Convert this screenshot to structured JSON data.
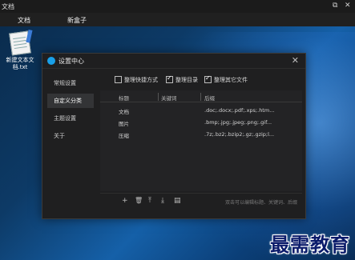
{
  "window_title": "文档",
  "taskbar": {
    "restore_glyph": "⧉",
    "close_glyph": "✕"
  },
  "tabs": [
    {
      "label": "文档"
    },
    {
      "label": "新盒子"
    }
  ],
  "desktop_icon": {
    "label_line1": "新建文本文",
    "label_line2": "档.txt"
  },
  "dialog": {
    "title": "设置中心",
    "close_glyph": "✕",
    "sidebar": [
      {
        "label": "常规设置"
      },
      {
        "label": "自定义分类"
      },
      {
        "label": "主题设置"
      },
      {
        "label": "关于"
      }
    ],
    "options": [
      {
        "label": "整理快捷方式",
        "checked": false
      },
      {
        "label": "整理目录",
        "checked": true
      },
      {
        "label": "整理其它文件",
        "checked": true
      }
    ],
    "table": {
      "columns": [
        "标题",
        "关键词",
        "后缀"
      ],
      "rows": [
        {
          "title": "文档",
          "keywords": "",
          "suffix": ".doc;.docx;.pdf;.xps;.htm..."
        },
        {
          "title": "图片",
          "keywords": "",
          "suffix": ".bmp;.jpg;.jpeg;.png;.gif..."
        },
        {
          "title": "压缩",
          "keywords": "",
          "suffix": ".7z;.bz2;.bzip2;.gz;.gzip;l..."
        }
      ]
    },
    "toolbar": {
      "add_glyph": "+",
      "delete_glyph": "🗑",
      "move_up_glyph": "⤒",
      "move_down_glyph": "⤓",
      "edit_glyph": "▤",
      "hint": "双击可以编辑标题、关键词、后缀"
    }
  },
  "watermark": "最需教育",
  "colors": {
    "accent": "#19a0e8",
    "dialog_bg": "#1f1f20",
    "sidebar_active": "#333436"
  }
}
